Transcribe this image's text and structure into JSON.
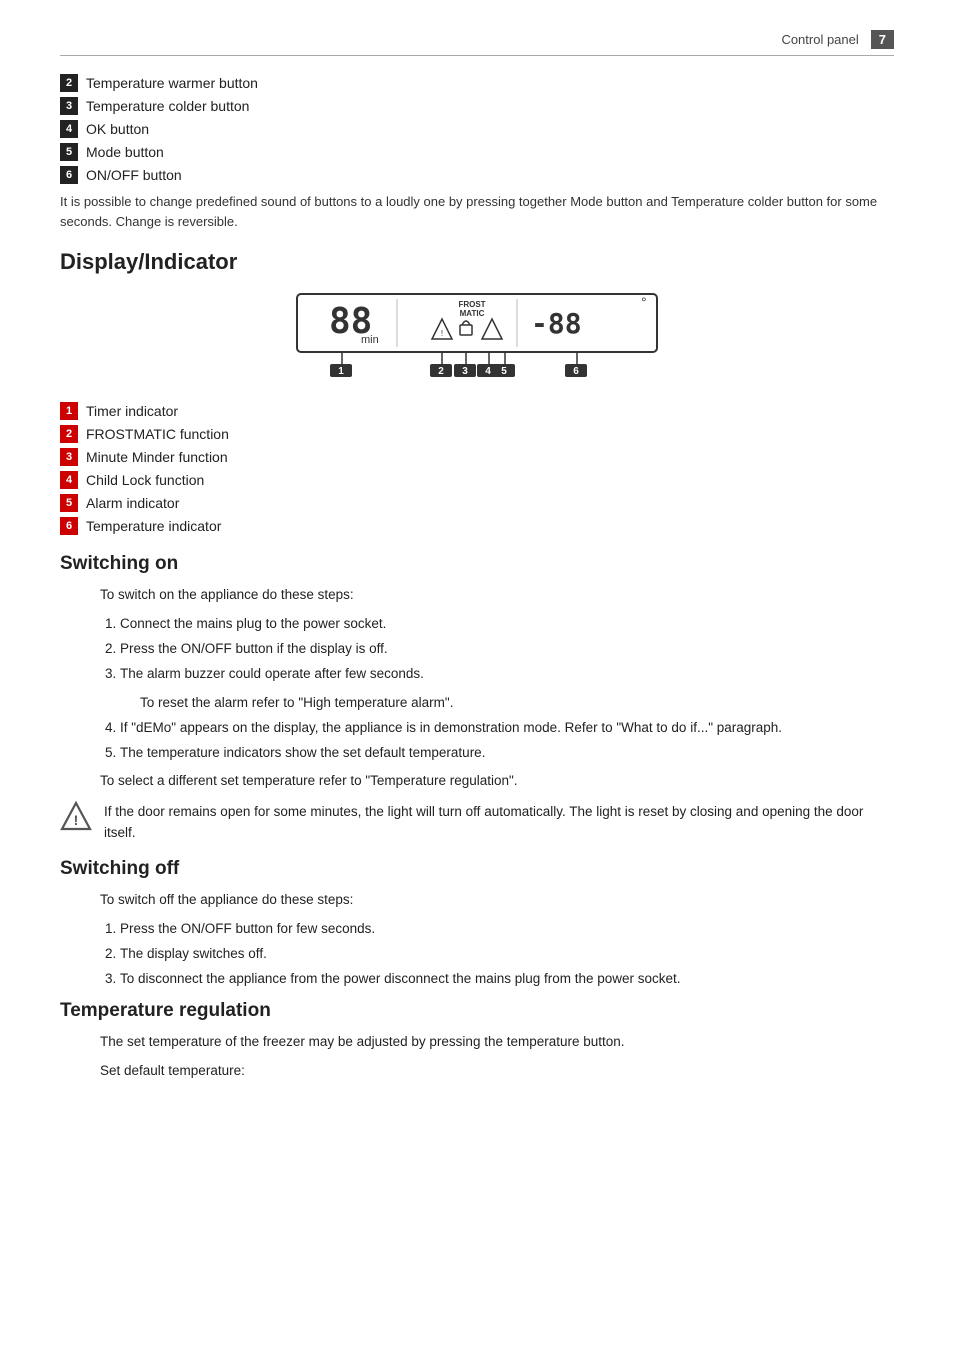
{
  "header": {
    "title": "Control panel",
    "page_number": "7"
  },
  "control_items": [
    {
      "number": "2",
      "label": "Temperature warmer button"
    },
    {
      "number": "3",
      "label": "Temperature colder button"
    },
    {
      "number": "4",
      "label": "OK button"
    },
    {
      "number": "5",
      "label": "Mode button"
    },
    {
      "number": "6",
      "label": "ON/OFF button"
    }
  ],
  "note": "It is possible to change predefined sound of buttons to a loudly one by pressing together Mode button and Temperature colder button for some seconds. Change is reversible.",
  "display_section": {
    "title": "Display/Indicator",
    "indicators": [
      {
        "number": "1",
        "label": "Timer indicator"
      },
      {
        "number": "2",
        "label": "FROSTMATIC function"
      },
      {
        "number": "3",
        "label": "Minute Minder function"
      },
      {
        "number": "4",
        "label": "Child Lock function"
      },
      {
        "number": "5",
        "label": "Alarm indicator"
      },
      {
        "number": "6",
        "label": "Temperature indicator"
      }
    ]
  },
  "switching_on": {
    "title": "Switching on",
    "intro": "To switch on the appliance do these steps:",
    "steps": [
      "Connect the mains plug to the power socket.",
      "Press the ON/OFF button if the display is off.",
      "The alarm buzzer could operate after few seconds.",
      "If \"dEMo\" appears on the display, the appliance is in demonstration mode. Refer to \"What to do if...\" paragraph.",
      "The temperature indicators show the set default temperature."
    ],
    "step3_sub": "To reset the alarm refer to \"High temperature alarm\".",
    "outro": "To select a different set temperature refer to \"Temperature regulation\".",
    "warning": "If the door remains open for some minutes, the light will turn off automatically. The light is reset by closing and opening the door itself."
  },
  "switching_off": {
    "title": "Switching off",
    "intro": "To switch off the appliance do these steps:",
    "steps": [
      "Press the ON/OFF button for few seconds.",
      "The display switches off.",
      "To disconnect the appliance from the power disconnect the mains plug from the power socket."
    ]
  },
  "temperature_regulation": {
    "title": "Temperature regulation",
    "text1": "The set temperature of the freezer may be adjusted by pressing the temperature button.",
    "text2": "Set default temperature:"
  }
}
